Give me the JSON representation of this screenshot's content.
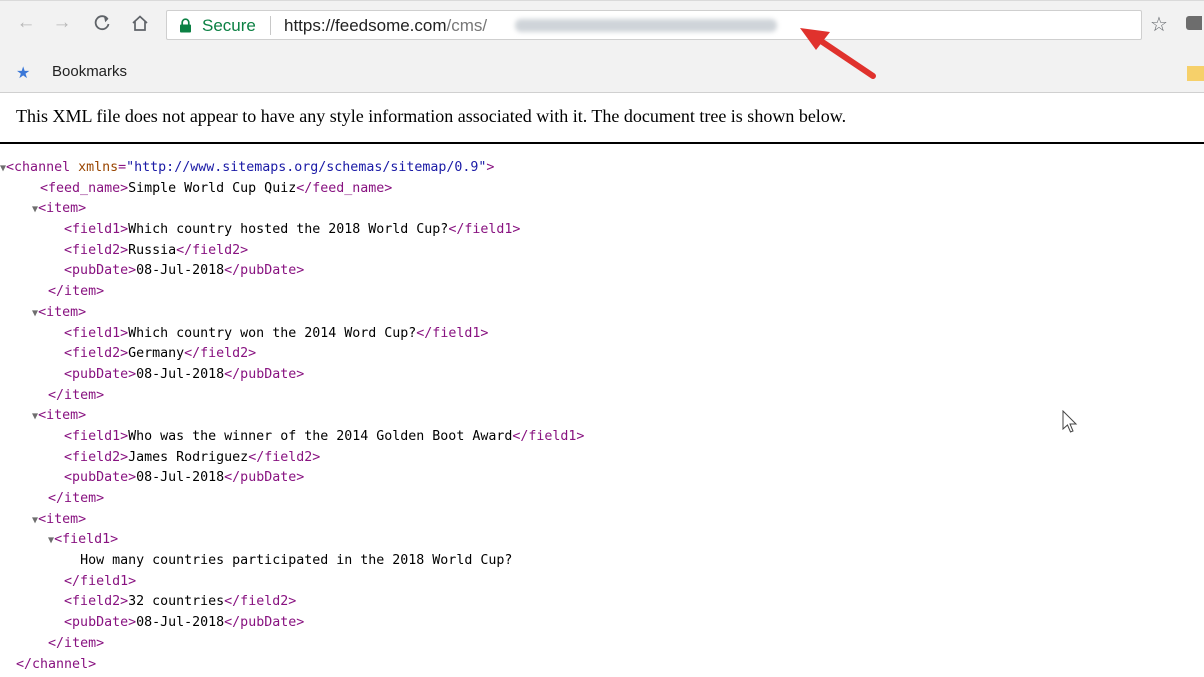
{
  "browser": {
    "secure_label": "Secure",
    "url_host": "https://feedsome.com",
    "url_path": "/cms/",
    "bookmarks_label": "Bookmarks"
  },
  "page": {
    "notice": "This XML file does not appear to have any style information associated with it. The document tree is shown below."
  },
  "xml": {
    "channel_tag": "channel",
    "xmlns_attr": "xmlns",
    "xmlns_value": "\"http://www.sitemaps.org/schemas/sitemap/0.9\"",
    "feed_name": "Simple World Cup Quiz",
    "items": [
      {
        "field1": "Which country hosted the 2018 World Cup?",
        "field2": "Russia",
        "pubDate": "08-Jul-2018"
      },
      {
        "field1": "Which country won the 2014 Word Cup?",
        "field2": "Germany",
        "pubDate": "08-Jul-2018"
      },
      {
        "field1": "Who was the winner of the 2014 Golden Boot Award",
        "field2": "James Rodriguez",
        "pubDate": "08-Jul-2018"
      },
      {
        "field1": "How many countries participated in the 2018 World Cup?",
        "field2": "32 countries",
        "pubDate": "08-Jul-2018"
      }
    ]
  },
  "icons": [
    "back-arrow-icon",
    "forward-arrow-icon",
    "reload-icon",
    "home-icon",
    "lock-icon",
    "bookmark-star-icon",
    "extension-icon",
    "bookmarks-star-icon",
    "folder-icon",
    "red-arrow-annotation-icon",
    "mouse-cursor-icon"
  ],
  "colors": {
    "secure": "#0b8043",
    "xml_tag": "#881280",
    "xml_attr": "#994500",
    "xml_attr_value": "#1a1aa6",
    "annotation_arrow": "#e0322d"
  }
}
